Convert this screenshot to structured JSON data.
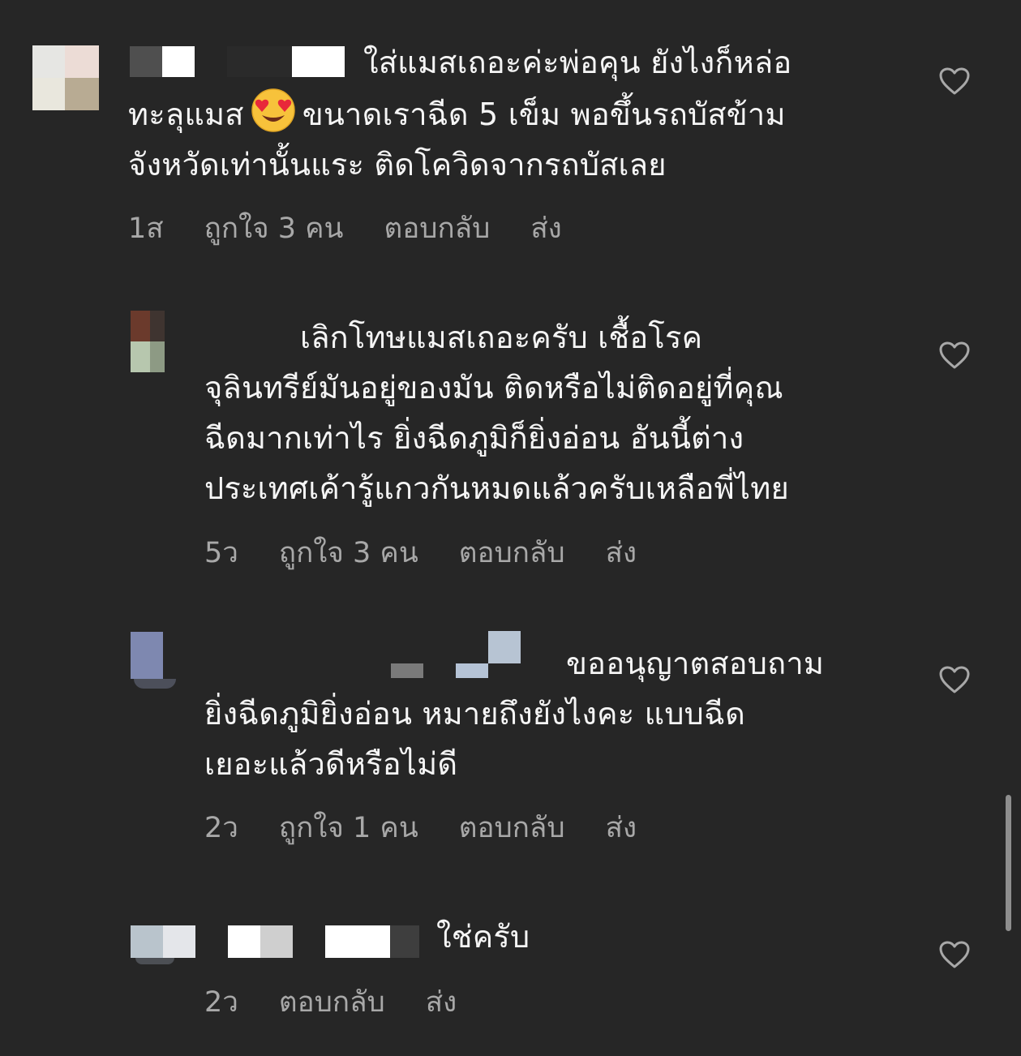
{
  "comments": [
    {
      "text_lines": [
        "ใส่แมสเถอะค่ะพ่อคุน ยังไงก็หล่อ",
        "ทะลุแมส",
        "ขนาดเราฉีด 5 เข็ม พอขึ้นรถบัสข้าม",
        "จังหวัดเท่านั้นแระ ติดโควิดจากรถบัสเลย"
      ],
      "emoji": "heart-eyes-emoji",
      "time": "1ส",
      "likes": "ถูกใจ 3 คน",
      "reply": "ตอบกลับ",
      "share": "ส่ง"
    },
    {
      "text_lines": [
        "เลิกโทษแมสเถอะครับ เชื้อโรค",
        "จุลินทรีย์มันอยู่ของมัน ติดหรือไม่ติดอยู่ที่คุณ",
        "ฉีดมากเท่าไร ยิ่งฉีดภูมิก็ยิ่งอ่อน อันนี้ต่าง",
        "ประเทศเค้ารู้แกวกันหมดแล้วครับเหลือพี่ไทย"
      ],
      "time": "5ว",
      "likes": "ถูกใจ 3 คน",
      "reply": "ตอบกลับ",
      "share": "ส่ง"
    },
    {
      "text_lines": [
        "ขออนุญาตสอบถาม",
        "ยิ่งฉีดภูมิยิ่งอ่อน หมายถึงยังไงคะ แบบฉีด",
        "เยอะแล้วดีหรือไม่ดี"
      ],
      "time": "2ว",
      "likes": "ถูกใจ 1 คน",
      "reply": "ตอบกลับ",
      "share": "ส่ง"
    },
    {
      "text_lines": [
        "ใช่ครับ"
      ],
      "time": "2ว",
      "reply": "ตอบกลับ",
      "share": "ส่ง"
    }
  ],
  "icons": {
    "like": "heart-outline-icon"
  },
  "colors": {
    "background": "#262626",
    "text": "#f5f5f5",
    "meta": "#a8a8a8"
  }
}
